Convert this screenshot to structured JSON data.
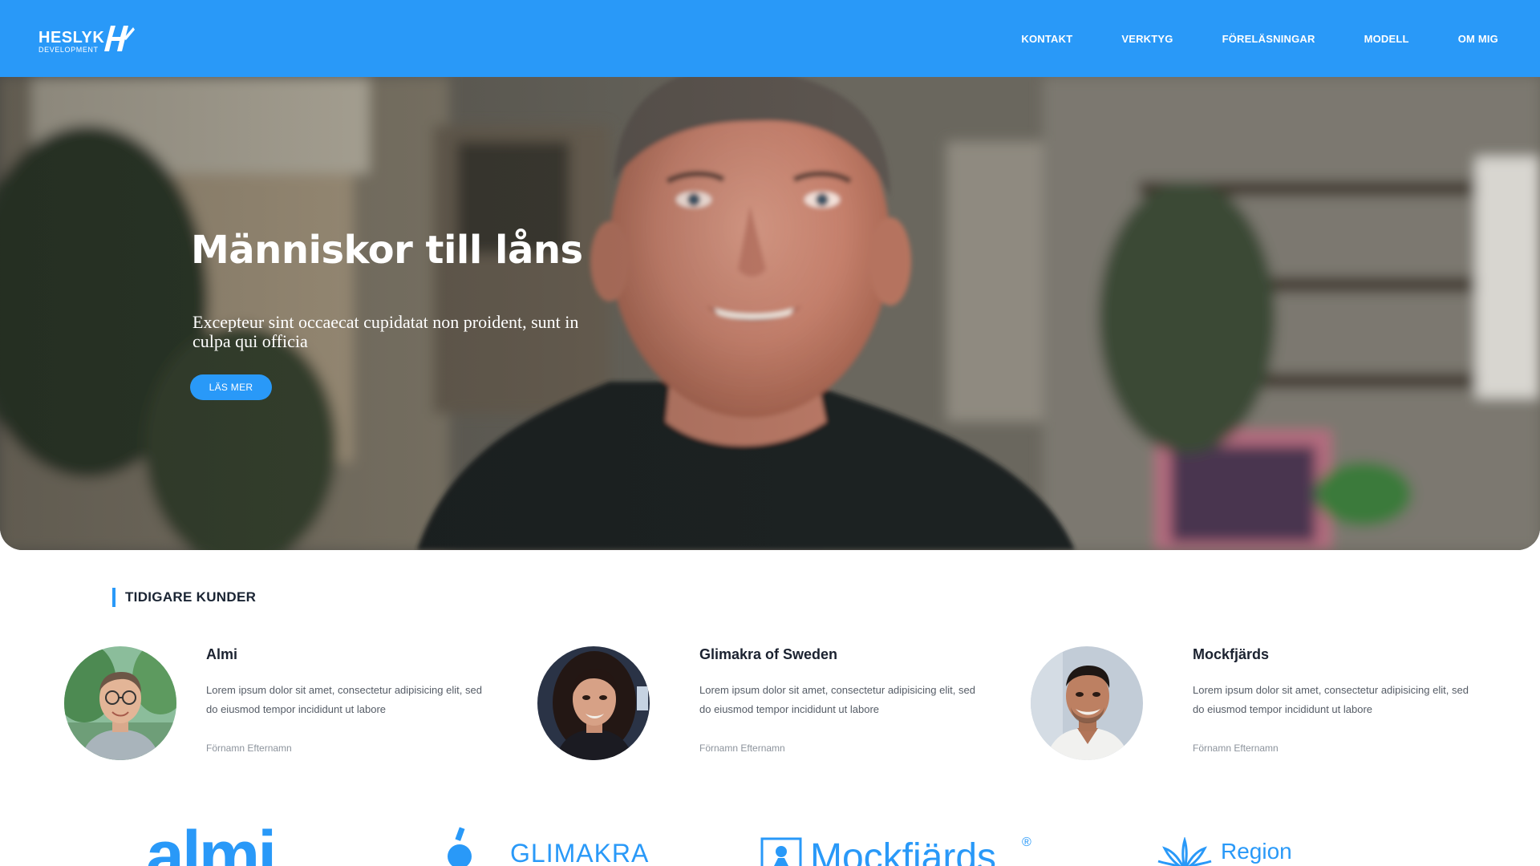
{
  "brand": {
    "name": "HESLYK",
    "sub": "DEVELOPMENT"
  },
  "nav": [
    "KONTAKT",
    "VERKTYG",
    "FÖRELÄSNINGAR",
    "MODELL",
    "OM MIG"
  ],
  "hero": {
    "title": "Människor till låns",
    "subtitle": "Excepteur sint occaecat cupidatat non proident, sunt in culpa qui officia",
    "button": "LÄS MER"
  },
  "section": {
    "title": "TIDIGARE KUNDER"
  },
  "clients": [
    {
      "name": "Almi",
      "text": "Lorem ipsum dolor sit amet, consectetur adipisicing elit, sed do eiusmod tempor incididunt ut labore",
      "person": "Förnamn Efternamn"
    },
    {
      "name": "Glimakra of Sweden",
      "text": "Lorem ipsum dolor sit amet, consectetur adipisicing elit, sed do eiusmod tempor incididunt ut labore",
      "person": "Förnamn Efternamn"
    },
    {
      "name": "Mockfjärds",
      "text": "Lorem ipsum dolor sit amet, consectetur adipisicing elit, sed do eiusmod tempor incididunt ut labore",
      "person": "Förnamn Efternamn"
    }
  ],
  "logos": [
    "almi",
    "GLIMAKRA",
    "Mockfjärds",
    "Region"
  ],
  "colors": {
    "accent": "#2999f8",
    "heading": "#1b2230",
    "muted": "#8c939c"
  }
}
